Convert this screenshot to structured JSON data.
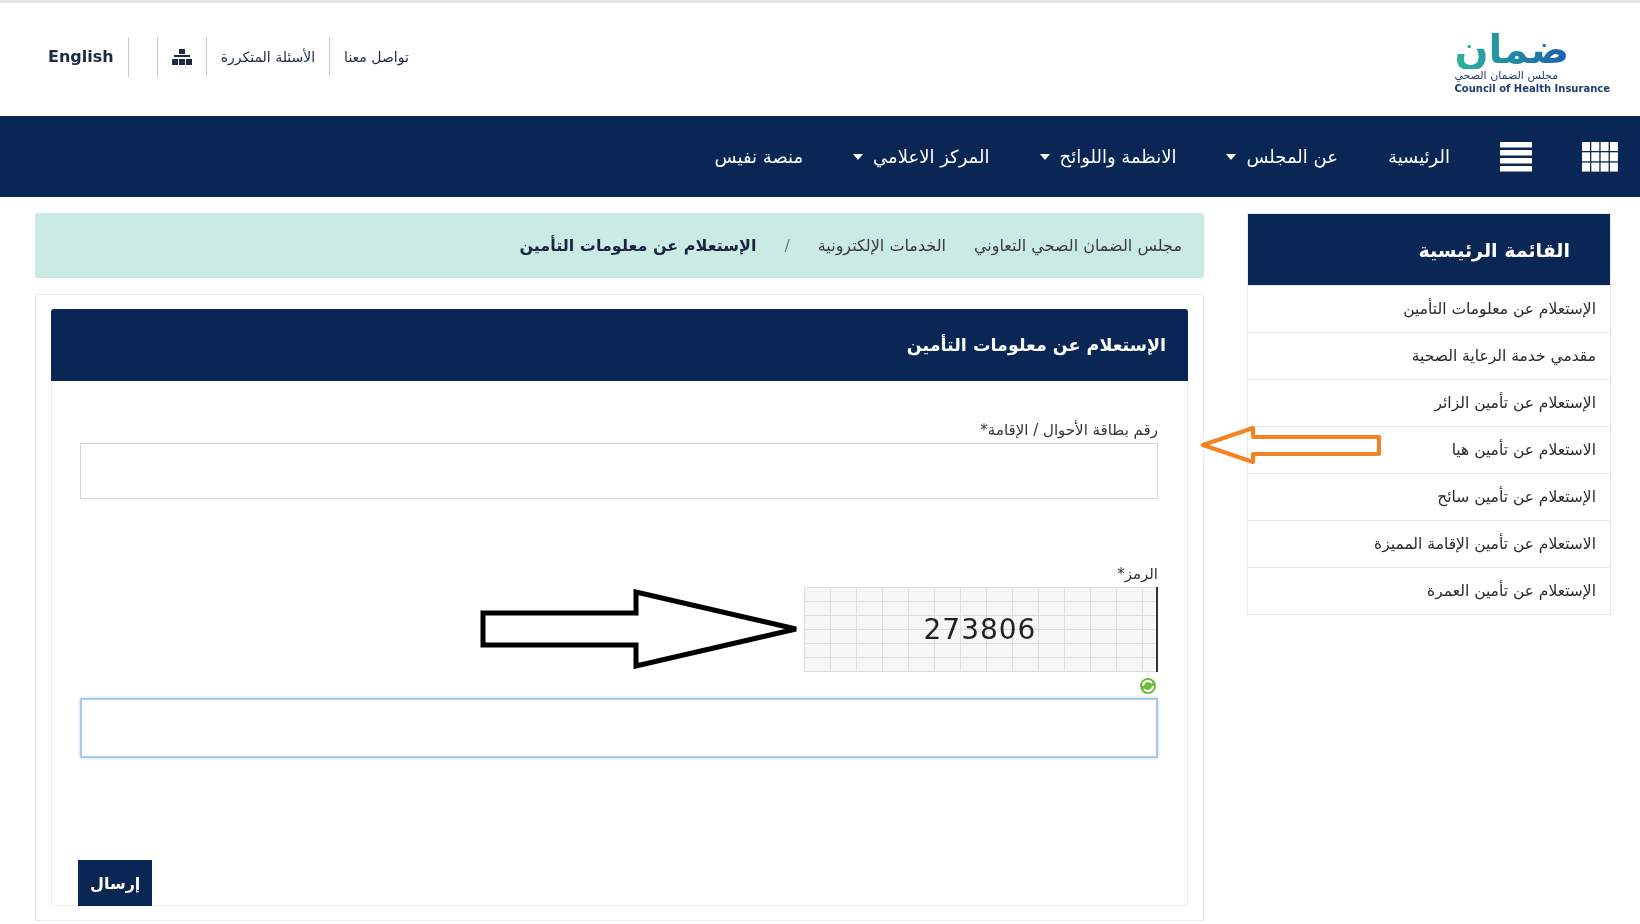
{
  "header": {
    "logo": {
      "wordmark": "ضمان",
      "name_ar": "مجلس الضمان الصحي",
      "name_en": "Council of Health Insurance"
    },
    "top_links": [
      {
        "kind": "text",
        "label": "تواصل معنا"
      },
      {
        "kind": "text",
        "label": "الأسئلة المتكررة"
      },
      {
        "kind": "sitemap-icon"
      },
      {
        "kind": "text",
        "label": "English"
      }
    ]
  },
  "nav": {
    "items": [
      {
        "label": "الرئيسية",
        "dropdown": false
      },
      {
        "label": "عن المجلس",
        "dropdown": true
      },
      {
        "label": "الانظمة واللوائح",
        "dropdown": true
      },
      {
        "label": "المركز الاعلامي",
        "dropdown": true
      },
      {
        "label": "منصة نفيس",
        "dropdown": false
      }
    ]
  },
  "sidebar": {
    "title": "القائمة الرئيسية",
    "items": [
      "الإستعلام عن معلومات التأمين",
      "مقدمي خدمة الرعاية الصحية",
      "الإستعلام عن تأمين الزائر",
      "الاستعلام عن تأمين هيا",
      "الإستعلام عن تأمين سائح",
      "الاستعلام عن تأمين الإقامة المميزة",
      "الإستعلام عن تأمين العمرة"
    ]
  },
  "breadcrumb": {
    "items": [
      {
        "label": "مجلس الضمان الصحي التعاوني",
        "current": false
      },
      {
        "label": "الخدمات الإلكترونية",
        "current": false
      },
      {
        "label": "الإستعلام عن معلومات التأمين",
        "current": true
      }
    ],
    "separator": "/"
  },
  "form": {
    "title": "الإستعلام عن معلومات التأمين",
    "fields": [
      {
        "kind": "text",
        "label": "رقم بطاقة الأحوال / الإقامة*",
        "focused": false,
        "arrow": {
          "color": "#f58220"
        }
      },
      {
        "kind": "captcha",
        "label": "الرمز*",
        "captcha_text": "273806",
        "focused": true,
        "arrow": {
          "color": "#000000"
        }
      }
    ],
    "submit": "إرسال"
  }
}
